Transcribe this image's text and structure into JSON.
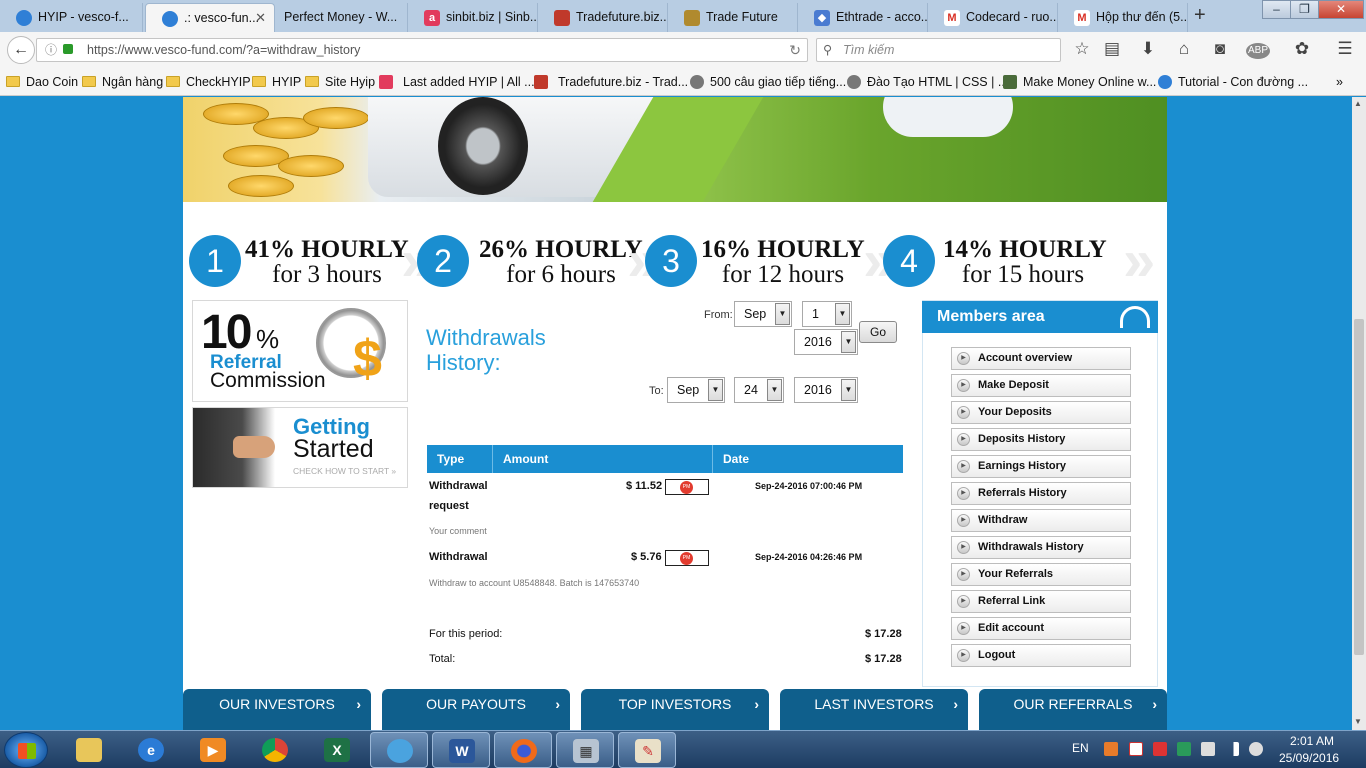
{
  "browser": {
    "tabs": [
      {
        "label": "HYIP - vesco-f...",
        "color": "#2f7fd6"
      },
      {
        "label": ".: vesco-fun...",
        "color": "#2f7fd6",
        "active": true
      },
      {
        "label": "Perfect Money - W...",
        "color": ""
      },
      {
        "label": "sinbit.biz | Sinb...",
        "color": "#e23b5d"
      },
      {
        "label": "Tradefuture.biz...",
        "color": "#c0392b"
      },
      {
        "label": "Trade Future",
        "color": "#b08a2e"
      },
      {
        "label": "Ethtrade - acco...",
        "color": "#4a7bd1"
      },
      {
        "label": "Codecard - ruo...",
        "color": "#d93025"
      },
      {
        "label": "Hộp thư đến (5...",
        "color": "#d93025"
      }
    ],
    "url": "https://www.vesco-fund.com/?a=withdraw_history",
    "search_placeholder": "Tìm kiếm",
    "bookmarks": [
      "Dao Coin",
      "Ngân hàng",
      "CheckHYIP",
      "HYIP",
      "Site Hyip",
      "Last added HYIP | All ...",
      "Tradefuture.biz - Trad...",
      "500 câu giao tiếp tiếng...",
      "Đào Tạo HTML | CSS | ...",
      "Make Money Online w...",
      "Tutorial - Con đường ..."
    ]
  },
  "plans": [
    {
      "num": "1",
      "rate": "41% HOURLY",
      "term": "for 3 hours"
    },
    {
      "num": "2",
      "rate": "26% HOURLY",
      "term": "for 6 hours"
    },
    {
      "num": "3",
      "rate": "16% HOURLY",
      "term": "for 12 hours"
    },
    {
      "num": "4",
      "rate": "14% HOURLY",
      "term": "for 15 hours"
    }
  ],
  "promo": {
    "big": "10",
    "pct": "%",
    "referral": "Referral",
    "commission": "Commission",
    "getting": "Getting",
    "started": "Started",
    "check": "CHECK HOW TO START"
  },
  "withdrawals": {
    "title_line1": "Withdrawals",
    "title_line2": "History:",
    "from_label": "From:",
    "to_label": "To:",
    "from_month": "Sep",
    "from_day": "1",
    "from_year": "2016",
    "to_month": "Sep",
    "to_day": "24",
    "to_year": "2016",
    "go_label": "Go",
    "col_type": "Type",
    "col_amount": "Amount",
    "col_date": "Date",
    "rows": [
      {
        "type_a": "Withdrawal",
        "type_b": "request",
        "amount": "$ 11.52",
        "date": "Sep-24-2016 07:00:46 PM",
        "note": "Your comment"
      },
      {
        "type_a": "Withdrawal",
        "type_b": "",
        "amount": "$ 5.76",
        "date": "Sep-24-2016 04:26:46 PM",
        "note": "Withdraw to account U8548848. Batch is 147653740"
      }
    ],
    "period_label": "For this period:",
    "period_value": "$ 17.28",
    "total_label": "Total:",
    "total_value": "$ 17.28",
    "pm_badge": "PM"
  },
  "members": {
    "title": "Members area",
    "items": [
      "Account overview",
      "Make Deposit",
      "Your Deposits",
      "Deposits History",
      "Earnings History",
      "Referrals History",
      "Withdraw",
      "Withdrawals History",
      "Your Referrals",
      "Referral Link",
      "Edit account",
      "Logout"
    ]
  },
  "footer_tabs": [
    "OUR INVESTORS",
    "OUR PAYOUTS",
    "TOP INVESTORS",
    "LAST INVESTORS",
    "OUR REFERRALS"
  ],
  "taskbar": {
    "lang": "EN",
    "time": "2:01 AM",
    "date": "25/09/2016"
  }
}
